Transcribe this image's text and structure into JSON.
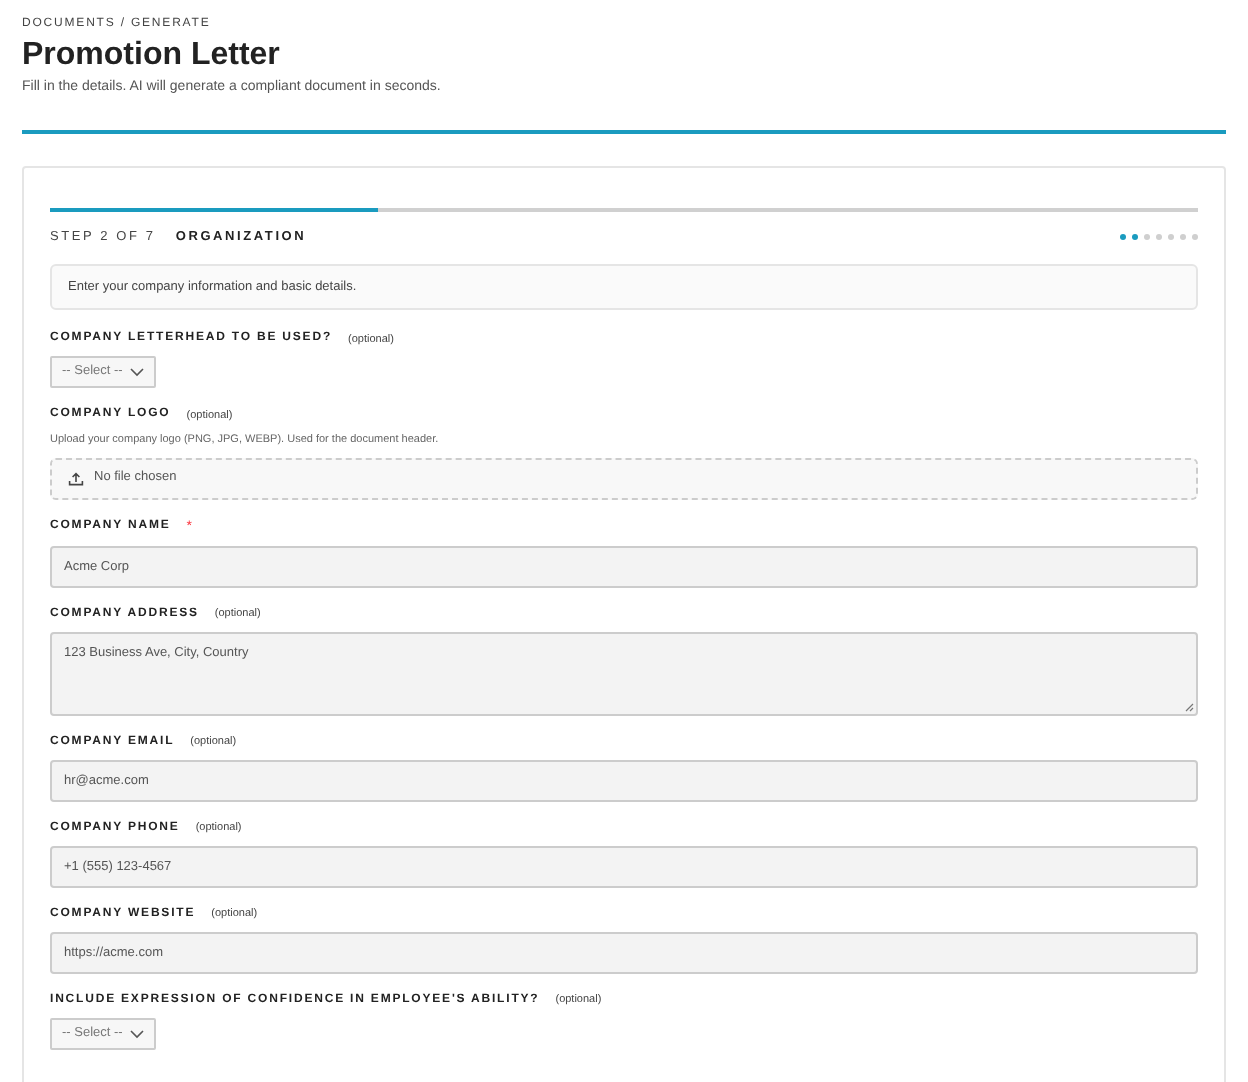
{
  "breadcrumb": "DOCUMENTS / GENERATE",
  "title": "Promotion Letter",
  "subtitle": "Fill in the details. AI will generate a compliant document in seconds.",
  "stepper": {
    "level": 0.285,
    "step_label": "STEP 2 OF 7",
    "step_name": "ORGANIZATION",
    "dots": [
      {
        "active": true
      },
      {
        "active": true
      },
      {
        "active": false
      },
      {
        "active": false
      },
      {
        "active": false
      },
      {
        "active": false
      },
      {
        "active": false
      }
    ]
  },
  "intro": "Enter your company information and basic details.",
  "fields": [
    {
      "kind": "select",
      "label": "COMPANY LETTERHEAD TO BE USED?",
      "note": "(optional)",
      "value": "-- Select --"
    },
    {
      "kind": "file",
      "label": "COMPANY LOGO",
      "note": "(optional)",
      "hint": "Upload your company logo (PNG, JPG, WEBP). Used for the document header.",
      "value": "No file chosen"
    },
    {
      "kind": "text",
      "label": "COMPANY NAME",
      "required_mark": "*",
      "value": "Acme Corp"
    },
    {
      "kind": "textarea",
      "label": "COMPANY ADDRESS",
      "note": "(optional)",
      "value": "123 Business Ave, City, Country"
    },
    {
      "kind": "text",
      "label": "COMPANY EMAIL",
      "note": "(optional)",
      "value": "hr@acme.com"
    },
    {
      "kind": "text",
      "label": "COMPANY PHONE",
      "note": "(optional)",
      "value": "+1 (555) 123-4567"
    },
    {
      "kind": "text",
      "label": "COMPANY WEBSITE",
      "note": "(optional)",
      "value": "https://acme.com"
    },
    {
      "kind": "select",
      "label": "INCLUDE EXPRESSION OF CONFIDENCE IN EMPLOYEE'S ABILITY?",
      "note": "(optional)",
      "value": "-- Select --"
    }
  ]
}
